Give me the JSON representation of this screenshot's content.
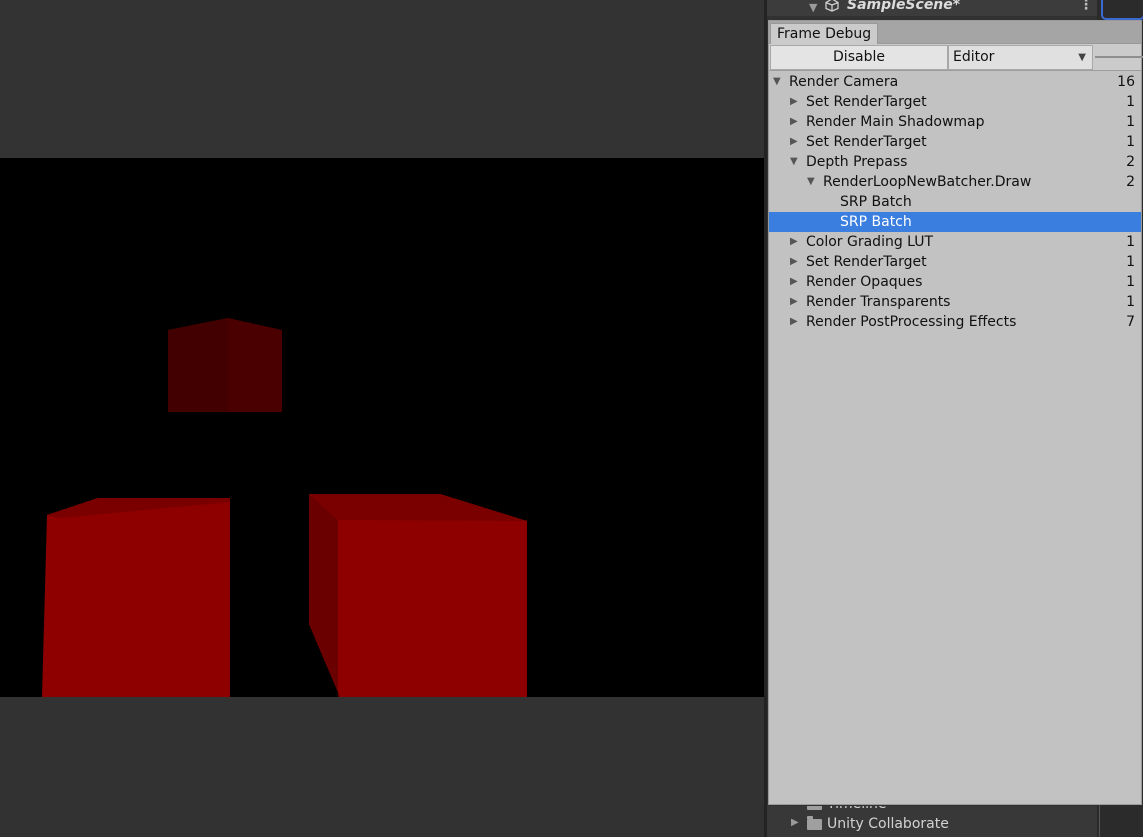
{
  "hierarchy": {
    "scene_name": "SampleScene*",
    "items": [
      {
        "label": "Timeline"
      },
      {
        "label": "Unity Collaborate"
      }
    ]
  },
  "frame_debug": {
    "tab_label": "Frame Debug",
    "disable_label": "Disable",
    "target_dropdown": "Editor",
    "events": [
      {
        "label": "Render Camera",
        "count": "16",
        "depth": 0,
        "expander": "expanded"
      },
      {
        "label": "Set RenderTarget",
        "count": "1",
        "depth": 1,
        "expander": "collapsed"
      },
      {
        "label": "Render Main Shadowmap",
        "count": "1",
        "depth": 1,
        "expander": "collapsed"
      },
      {
        "label": "Set RenderTarget",
        "count": "1",
        "depth": 1,
        "expander": "collapsed"
      },
      {
        "label": "Depth Prepass",
        "count": "2",
        "depth": 1,
        "expander": "expanded"
      },
      {
        "label": "RenderLoopNewBatcher.Draw",
        "count": "2",
        "depth": 2,
        "expander": "expanded"
      },
      {
        "label": "SRP Batch",
        "count": "",
        "depth": 3,
        "expander": "none"
      },
      {
        "label": "SRP Batch",
        "count": "",
        "depth": 3,
        "expander": "none",
        "selected": true
      },
      {
        "label": "Color Grading LUT",
        "count": "1",
        "depth": 1,
        "expander": "collapsed"
      },
      {
        "label": "Set RenderTarget",
        "count": "1",
        "depth": 1,
        "expander": "collapsed"
      },
      {
        "label": "Render Opaques",
        "count": "1",
        "depth": 1,
        "expander": "collapsed"
      },
      {
        "label": "Render Transparents",
        "count": "1",
        "depth": 1,
        "expander": "collapsed"
      },
      {
        "label": "Render PostProcessing Effects",
        "count": "7",
        "depth": 1,
        "expander": "collapsed"
      }
    ]
  },
  "colors": {
    "selection": "#3a7ee0",
    "cube_front": "#8e0000",
    "cube_side": "#6a0000",
    "cube_top": "#7a0000",
    "far_cube": "#4a0000"
  },
  "icons": {
    "expanded": "triangle-down-icon",
    "collapsed": "triangle-right-icon",
    "scene": "unity-scene-icon",
    "folder": "folder-icon",
    "menu": "kebab-menu-icon"
  }
}
